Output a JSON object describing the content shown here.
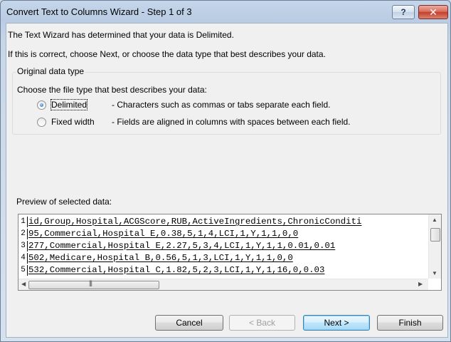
{
  "window": {
    "title": "Convert Text to Columns Wizard - Step 1 of 3",
    "help_label": "?",
    "close_label": "✕"
  },
  "intro": {
    "line1": "The Text Wizard has determined that your data is Delimited.",
    "line2": "If this is correct, choose Next, or choose the data type that best describes your data."
  },
  "original_data_type": {
    "legend": "Original data type",
    "prompt": "Choose the file type that best describes your data:",
    "options": [
      {
        "label": "Delimited",
        "description": "- Characters such as commas or tabs separate each field.",
        "selected": true
      },
      {
        "label": "Fixed width",
        "description": "- Fields are aligned in columns with spaces between each field.",
        "selected": false
      }
    ]
  },
  "preview": {
    "label": "Preview of selected data:",
    "rows": [
      {
        "num": "1",
        "text": "id,Group,Hospital,ACGScore,RUB,ActiveIngredients,ChronicConditi"
      },
      {
        "num": "2",
        "text": "95,Commercial,Hospital E,0.38,5,1,4,LCI,1,Y,1,1,0,0"
      },
      {
        "num": "3",
        "text": "277,Commercial,Hospital E,2.27,5,3,4,LCI,1,Y,1,1,0.01,0.01"
      },
      {
        "num": "4",
        "text": "502,Medicare,Hospital B,0.56,5,1,3,LCI,1,Y,1,1,0,0"
      },
      {
        "num": "5",
        "text": "532,Commercial,Hospital C,1.82,5,2,3,LCI,1,Y,1,16,0,0.03"
      }
    ]
  },
  "buttons": {
    "cancel": "Cancel",
    "back": "< Back",
    "next": "Next >",
    "finish": "Finish"
  }
}
